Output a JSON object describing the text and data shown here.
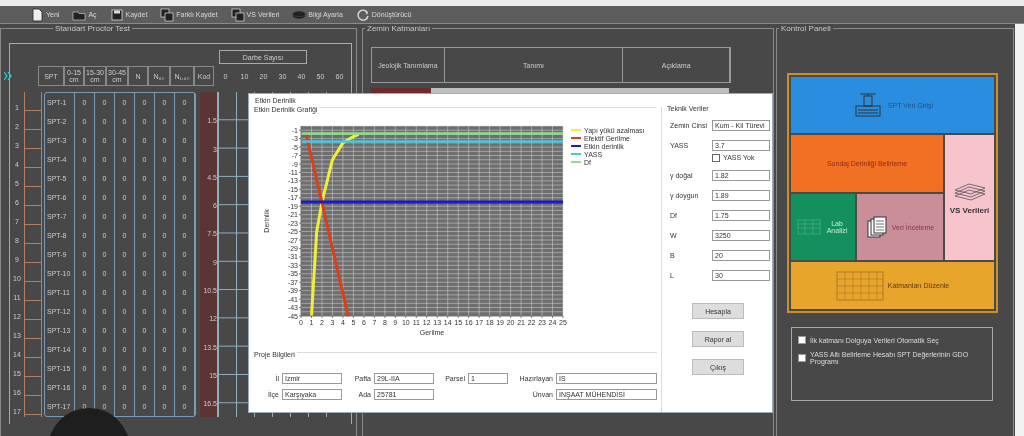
{
  "toolbar": [
    {
      "label": "Yeni"
    },
    {
      "label": "Aç"
    },
    {
      "label": "Kaydet"
    },
    {
      "label": "Farklı Kaydet"
    },
    {
      "label": "VS Verileri"
    },
    {
      "label": "Bilgi Ayarla"
    },
    {
      "label": "Dönüştürücü"
    }
  ],
  "proctor": {
    "title": "Standart Proctor Test",
    "group_header": "Darbe Sayısı",
    "columns": [
      "SPT",
      "0-15 cm",
      "15-30 cm",
      "30-45 cm",
      "N",
      "N₆₀",
      "N₁,₆₀",
      "Kod"
    ],
    "scale_labels": [
      "0",
      "10",
      "20",
      "30",
      "40",
      "50",
      "60"
    ],
    "depth_labels": [
      "1.5",
      "3",
      "4.5",
      "6",
      "7.5",
      "9",
      "10.5",
      "12",
      "13.5",
      "15",
      "16.5"
    ],
    "rows": [
      {
        "number": "1",
        "name": "SPT-1",
        "values": [
          "0",
          "0",
          "0",
          "0",
          "0",
          "0"
        ]
      },
      {
        "number": "2",
        "name": "SPT-2",
        "values": [
          "0",
          "0",
          "0",
          "0",
          "0",
          "0"
        ]
      },
      {
        "number": "3",
        "name": "SPT-3",
        "values": [
          "0",
          "0",
          "0",
          "0",
          "0",
          "0"
        ]
      },
      {
        "number": "4",
        "name": "SPT-4",
        "values": [
          "0",
          "0",
          "0",
          "0",
          "0",
          "0"
        ]
      },
      {
        "number": "5",
        "name": "SPT-5",
        "values": [
          "0",
          "0",
          "0",
          "0",
          "0",
          "0"
        ]
      },
      {
        "number": "6",
        "name": "SPT-6",
        "values": [
          "0",
          "0",
          "0",
          "0",
          "0",
          "0"
        ]
      },
      {
        "number": "7",
        "name": "SPT-7",
        "values": [
          "0",
          "0",
          "0",
          "0",
          "0",
          "0"
        ]
      },
      {
        "number": "8",
        "name": "SPT-8",
        "values": [
          "0",
          "0",
          "0",
          "0",
          "0",
          "0"
        ]
      },
      {
        "number": "9",
        "name": "SPT-9",
        "values": [
          "0",
          "0",
          "0",
          "0",
          "0",
          "0"
        ]
      },
      {
        "number": "10",
        "name": "SPT-10",
        "values": [
          "0",
          "0",
          "0",
          "0",
          "0",
          "0"
        ]
      },
      {
        "number": "11",
        "name": "SPT-11",
        "values": [
          "0",
          "0",
          "0",
          "0",
          "0",
          "0"
        ]
      },
      {
        "number": "12",
        "name": "SPT-12",
        "values": [
          "0",
          "0",
          "0",
          "0",
          "0",
          "0"
        ]
      },
      {
        "number": "13",
        "name": "SPT-13",
        "values": [
          "0",
          "0",
          "0",
          "0",
          "0",
          "0"
        ]
      },
      {
        "number": "14",
        "name": "SPT-14",
        "values": [
          "0",
          "0",
          "0",
          "0",
          "0",
          "0"
        ]
      },
      {
        "number": "15",
        "name": "SPT-15",
        "values": [
          "0",
          "0",
          "0",
          "0",
          "0",
          "0"
        ]
      },
      {
        "number": "16",
        "name": "SPT-16",
        "values": [
          "0",
          "0",
          "0",
          "0",
          "0",
          "0"
        ]
      },
      {
        "number": "17",
        "name": "SPT-17",
        "values": [
          "0",
          "0",
          "0",
          "0",
          "0",
          "0"
        ]
      }
    ]
  },
  "layers": {
    "title": "Zemin Katmanları",
    "columns": [
      "Jeolojik Tanımlama",
      "Tanımı",
      "Açıklama"
    ]
  },
  "control_panel": {
    "title": "Kontrol Paneli",
    "tiles": [
      {
        "label": "SPT Veri Girişi",
        "color": "#2a8de0"
      },
      {
        "label": "Sondaj Derinliği Belirleme",
        "color": "#f27024"
      },
      {
        "label": "VS Verileri",
        "color": "#f8c4cc"
      },
      {
        "label": "Lab Analizi",
        "color": "#13905e"
      },
      {
        "label": "Veri İnceleme",
        "color": "#c98e98"
      },
      {
        "label": "Katmanları Düzenle",
        "color": "#e8a52c"
      }
    ],
    "options": [
      {
        "label": "İlk katmanı Dolguya Verileri Otomatik Seç",
        "checked": false
      },
      {
        "label": "YASS Altı Belirleme Hesabı SPT Değerlerinin GDO Programı",
        "checked": false
      }
    ]
  },
  "dialog": {
    "title": "Etkin Derinlik",
    "chart_title": "Etkin Derinlik Grafiği",
    "chart_data": {
      "type": "line",
      "xlabel": "Gerilme",
      "ylabel": "Derinlik",
      "x": [
        0,
        0.5,
        1,
        1.5,
        2,
        3,
        4,
        4.5,
        5,
        5.5,
        25
      ],
      "series": [
        {
          "name": "Yapı yükü azalması",
          "color": "#f0ee3a",
          "values": [
            null,
            null,
            -45,
            -25,
            -18,
            -8,
            -4,
            -3.2,
            -2.5,
            -2,
            null
          ]
        },
        {
          "name": "Efektif Gerilme",
          "color": "#d8401c",
          "values": [
            null,
            -2,
            -7.4,
            -12.8,
            -18.1,
            -28.9,
            -39.6,
            -45,
            null,
            null,
            null
          ]
        },
        {
          "name": "Etkin derinlik",
          "color": "#1a1ac8",
          "values": [
            -18,
            -18,
            -18,
            -18,
            -18,
            -18,
            -18,
            -18,
            -18,
            -18,
            -18
          ]
        },
        {
          "name": "YASS",
          "color": "#44c8e4",
          "values": [
            -3.7,
            -3.7,
            -3.7,
            -3.7,
            -3.7,
            -3.7,
            -3.7,
            -3.7,
            -3.7,
            -3.7,
            -3.7
          ]
        },
        {
          "name": "Df",
          "color": "#88e088",
          "values": [
            -1.75,
            -1.75,
            -1.75,
            -1.75,
            -1.75,
            -1.75,
            -1.75,
            -1.75,
            -1.75,
            -1.75,
            -1.75
          ]
        }
      ],
      "grid": true,
      "legend": "right",
      "xlim": [
        0,
        25
      ],
      "ylim": [
        -45,
        0
      ],
      "xticks": [
        0,
        1,
        2,
        3,
        4,
        5,
        6,
        7,
        8,
        9,
        10,
        11,
        12,
        13,
        14,
        15,
        16,
        17,
        18,
        19,
        20,
        21,
        22,
        23,
        24,
        25
      ],
      "yticks": [
        -1,
        -3,
        -5,
        -7,
        -9,
        -11,
        -13,
        -15,
        -17,
        -19,
        -21,
        -23,
        -25,
        -27,
        -29,
        -31,
        -33,
        -35,
        -37,
        -39,
        -41,
        -43,
        -45
      ]
    },
    "technical": {
      "title": "Teknik Veriler",
      "fields": [
        {
          "kind": "text",
          "label": "Zemin Cinsi",
          "value": "Kum - Kil Türevi"
        },
        {
          "kind": "text",
          "label": "YASS",
          "value": "3.7"
        },
        {
          "kind": "checkbox",
          "label": "YASS Yok",
          "checked": false
        },
        {
          "kind": "text",
          "label": "γ doğal",
          "value": "1.82"
        },
        {
          "kind": "text",
          "label": "γ doygun",
          "value": "1.89"
        },
        {
          "kind": "text",
          "label": "Df",
          "value": "1.75"
        },
        {
          "kind": "text",
          "label": "W",
          "value": "3250"
        },
        {
          "kind": "text",
          "label": "B",
          "value": "20"
        },
        {
          "kind": "text",
          "label": "L",
          "value": "30"
        }
      ],
      "buttons": [
        "Hesapla",
        "Rapor al",
        "Çıkış"
      ]
    },
    "project": {
      "title": "Proje Bilgileri",
      "fields": [
        {
          "label": "İl",
          "value": "İzmir"
        },
        {
          "label": "Pafta",
          "value": "29L-IIA"
        },
        {
          "label": "Parsel",
          "value": "1"
        },
        {
          "label": "Hazırlayan",
          "value": "İS"
        },
        {
          "label": "İlçe",
          "value": "Karşıyaka"
        },
        {
          "label": "Ada",
          "value": "25781"
        },
        {
          "label": "Ünvan",
          "value": "İNŞAAT MÜHENDİSİ"
        }
      ]
    }
  }
}
